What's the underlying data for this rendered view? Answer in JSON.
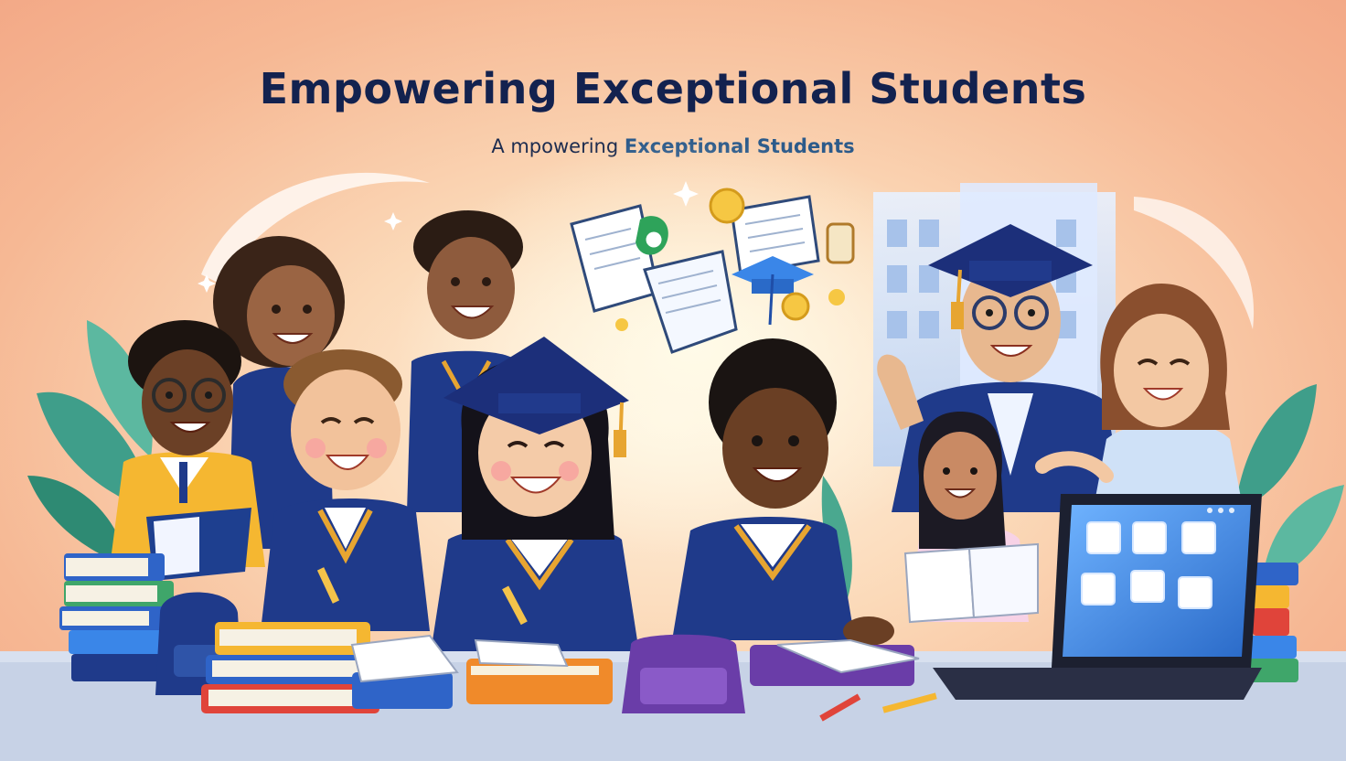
{
  "headline": {
    "title": "Empowering Exceptional Students",
    "subtitle_prefix": "A mpowering",
    "subtitle_accent": "Exceptional Students"
  },
  "colors": {
    "title": "#13224f",
    "uniform": "#1f3a8a",
    "gold_trim": "#e7a531",
    "background_peach": "#f6b894",
    "desk": "#c7d2e6"
  },
  "icons": [
    "graduation-cap-icon",
    "open-book-icon",
    "diploma-scroll-icon",
    "coin-icon",
    "laptop-icon",
    "sparkle-icon",
    "pencil-icon",
    "backpack-icon",
    "leaf-icon"
  ]
}
